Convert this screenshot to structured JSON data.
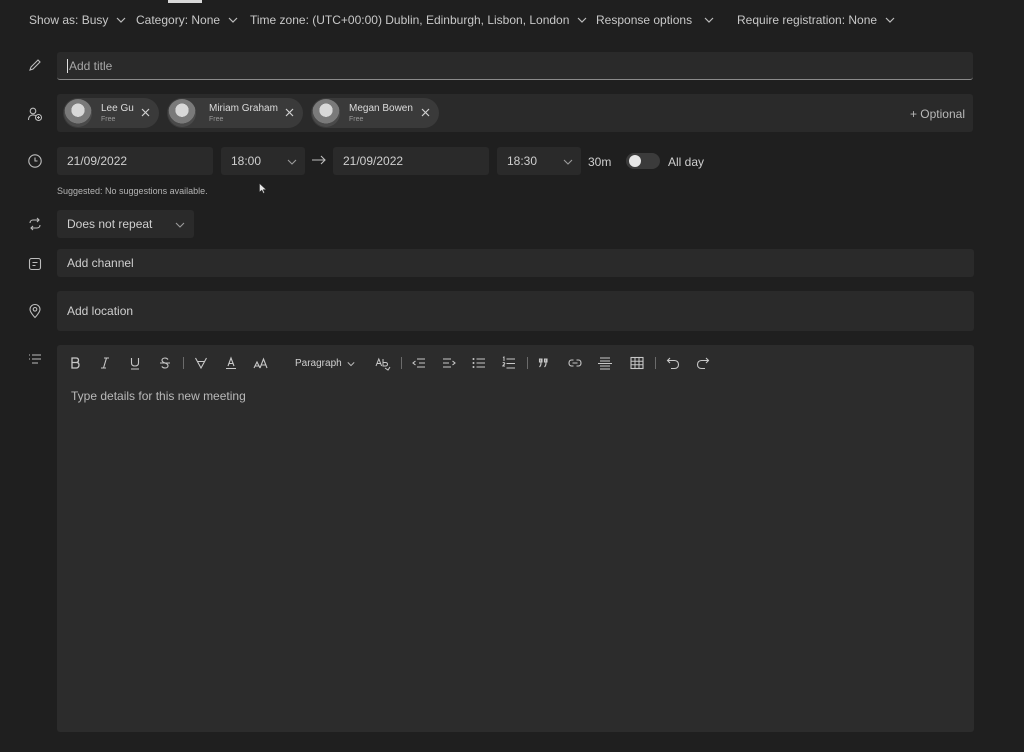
{
  "options_bar": {
    "show_as": "Show as: Busy",
    "category": "Category: None",
    "time_zone": "Time zone: (UTC+00:00) Dublin, Edinburgh, Lisbon, London",
    "response_options": "Response options",
    "require_registration": "Require registration: None"
  },
  "title": {
    "placeholder": "Add title"
  },
  "attendees": {
    "people": [
      {
        "name": "Lee Gu",
        "status": "Free"
      },
      {
        "name": "Miriam Graham",
        "status": "Free"
      },
      {
        "name": "Megan Bowen",
        "status": "Free"
      }
    ],
    "optional_label": "+ Optional"
  },
  "schedule": {
    "start_date": "21/09/2022",
    "start_time": "18:00",
    "end_date": "21/09/2022",
    "end_time": "18:30",
    "duration": "30m",
    "all_day_label": "All day",
    "all_day_on": false,
    "suggested": "Suggested: No suggestions available."
  },
  "repeat": {
    "value": "Does not repeat"
  },
  "channel": {
    "placeholder": "Add channel"
  },
  "location": {
    "placeholder": "Add location"
  },
  "editor": {
    "paragraph_label": "Paragraph",
    "placeholder": "Type details for this new meeting"
  },
  "icons": {
    "title": "pencil-icon",
    "attendees": "people-add-icon",
    "time": "clock-icon",
    "repeat": "repeat-icon",
    "channel": "channel-icon",
    "location": "location-pin-icon",
    "details": "text-lines-icon"
  }
}
